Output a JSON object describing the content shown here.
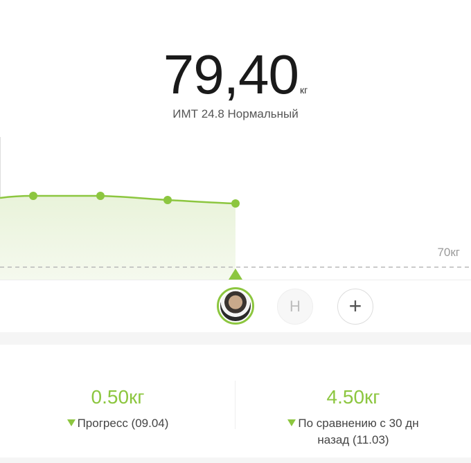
{
  "header": {
    "weight_value": "79,40",
    "weight_unit": "кг",
    "bmi_text": "ИМТ 24.8 Нормальный"
  },
  "chart": {
    "reference_label": "70кг",
    "reference_weight_kg": 70,
    "accent_color": "#8cc63f"
  },
  "users": {
    "avatar_icon": "user-photo",
    "second_user_initial": "Н",
    "add_label": "+"
  },
  "stats": {
    "left": {
      "value": "0.50кг",
      "caption": "Прогресс (09.04)"
    },
    "right": {
      "value": "4.50кг",
      "caption_line1": "По сравнению с 30 дн",
      "caption_line2": "назад (11.03)"
    }
  },
  "colors": {
    "accent": "#8cc63f",
    "muted_text": "#9a9a9a"
  }
}
